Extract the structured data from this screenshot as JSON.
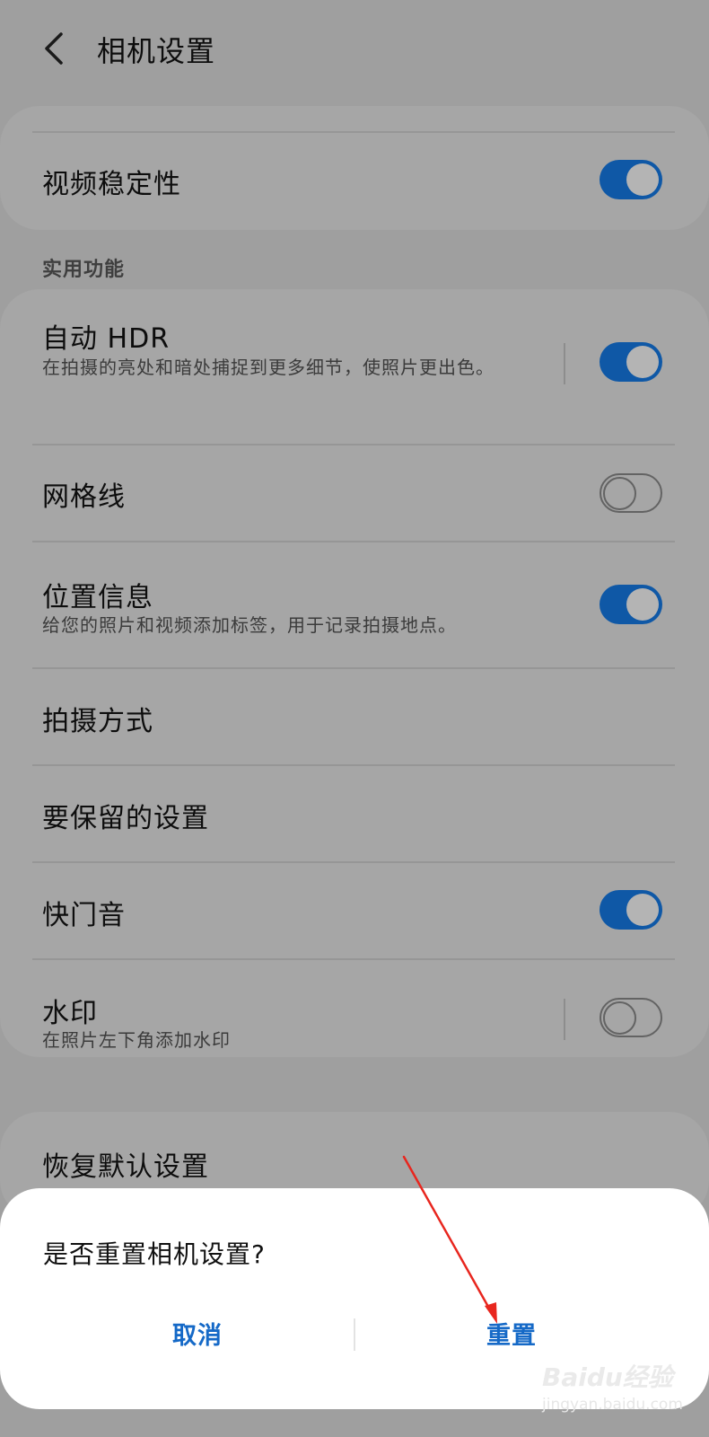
{
  "header": {
    "title": "相机设置"
  },
  "top_card": {
    "items": [
      {
        "label": "视频稳定性",
        "toggle": true
      }
    ]
  },
  "section_practical": {
    "title": "实用功能"
  },
  "practical_card": {
    "items": [
      {
        "label": "自动 HDR",
        "desc": "在拍摄的亮处和暗处捕捉到更多细节，使照片更出色。",
        "toggle": true
      },
      {
        "label": "网格线",
        "toggle": false
      },
      {
        "label": "位置信息",
        "desc": "给您的照片和视频添加标签，用于记录拍摄地点。",
        "toggle": true
      },
      {
        "label": "拍摄方式"
      },
      {
        "label": "要保留的设置"
      },
      {
        "label": "快门音",
        "toggle": true
      },
      {
        "label": "水印",
        "desc": "在照片左下角添加水印",
        "toggle": false
      }
    ]
  },
  "reset_card": {
    "label": "恢复默认设置"
  },
  "dialog": {
    "question": "是否重置相机设置?",
    "cancel_label": "取消",
    "confirm_label": "重置"
  },
  "watermark": {
    "logo": "Baidu经验",
    "url": "jingyan.baidu.com"
  },
  "colors": {
    "accent": "#1569c7",
    "toggle_on": "#0f58a6",
    "annotation_arrow": "#e8261e"
  }
}
